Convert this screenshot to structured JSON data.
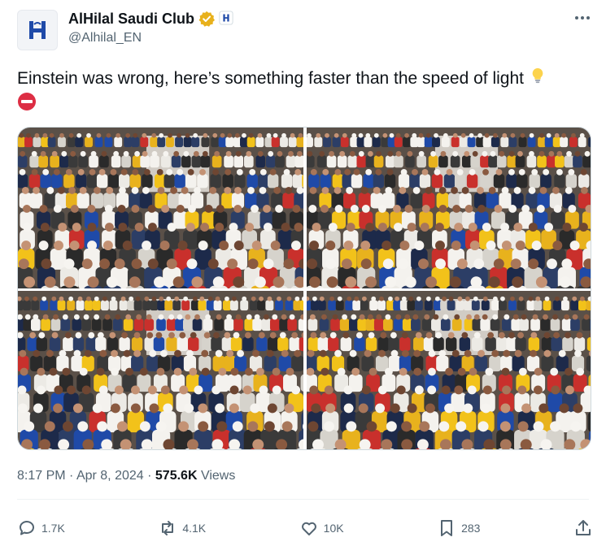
{
  "author": {
    "display_name": "AlHilal Saudi Club",
    "handle": "@Alhilal_EN",
    "avatar_icon": "alhilal-crest-logo",
    "verified_color": "#e8b11c"
  },
  "tweet": {
    "text": "Einstein was wrong,  here’s something faster than the speed of light",
    "emojis": [
      "lightbulb-emoji",
      "no-entry-emoji"
    ]
  },
  "media": {
    "photos": [
      {
        "name": "crowd-photo-1"
      },
      {
        "name": "crowd-photo-2"
      },
      {
        "name": "crowd-photo-3"
      },
      {
        "name": "crowd-photo-4"
      }
    ]
  },
  "meta": {
    "time": "8:17 PM",
    "date": "Apr 8, 2024",
    "separator": "·",
    "views_count": "575.6K",
    "views_label": "Views"
  },
  "actions": {
    "replies": "1.7K",
    "reposts": "4.1K",
    "likes": "10K",
    "bookmarks": "283"
  },
  "colors": {
    "text": "#0f1419",
    "secondary": "#536471",
    "hilal_blue": "#1f4aa8",
    "nassr_yellow": "#f2c21a"
  }
}
